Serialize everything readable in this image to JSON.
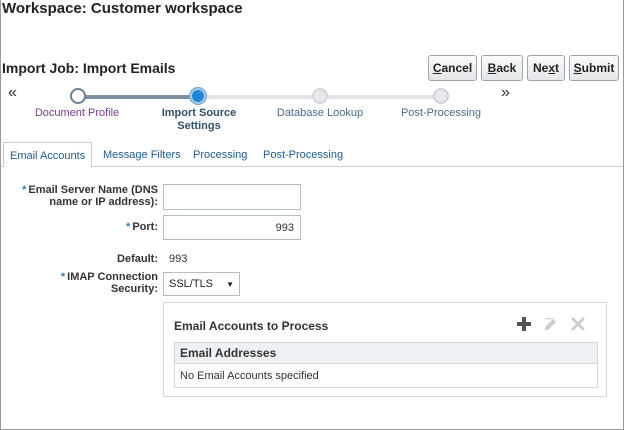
{
  "workspace": {
    "title": "Workspace: Customer workspace"
  },
  "job": {
    "title": "Import Job: Import Emails",
    "buttons": [
      {
        "label_pre": "",
        "label_u": "C",
        "label_post": "ancel"
      },
      {
        "label_pre": "",
        "label_u": "B",
        "label_post": "ack"
      },
      {
        "label_pre": "Ne",
        "label_u": "x",
        "label_post": "t"
      },
      {
        "label_pre": "",
        "label_u": "S",
        "label_post": "ubmit"
      }
    ]
  },
  "train": {
    "prev_arrow": "«",
    "next_arrow": "»",
    "steps": [
      {
        "label": "Document Profile",
        "state": "visited"
      },
      {
        "label": "Import Source Settings",
        "state": "current"
      },
      {
        "label": "Database Lookup",
        "state": "future"
      },
      {
        "label": "Post-Processing",
        "state": "future"
      }
    ]
  },
  "tabs": [
    {
      "label": "Email Accounts",
      "active": true
    },
    {
      "label": "Message Filters",
      "active": false
    },
    {
      "label": "Processing",
      "active": false
    },
    {
      "label": "Post-Processing",
      "active": false
    }
  ],
  "form": {
    "required_mark": "*",
    "server_label_line1": "Email Server Name (DNS",
    "server_label_line2": "name or IP address):",
    "server_value": "",
    "port_label": "Port:",
    "port_value": "993",
    "default_label": "Default:",
    "default_value": "993",
    "imap_label_line1": "IMAP Connection",
    "imap_label_line2": "Security:",
    "imap_value": "SSL/TLS"
  },
  "accounts_panel": {
    "title": "Email Accounts to Process",
    "icons": [
      "add-icon",
      "edit-icon",
      "delete-icon"
    ],
    "column_header": "Email Addresses",
    "empty_text": "No Email Accounts specified"
  },
  "colors": {
    "accent": "#1e88d6",
    "link": "#1f5a8c",
    "visited": "#7a3a91"
  }
}
